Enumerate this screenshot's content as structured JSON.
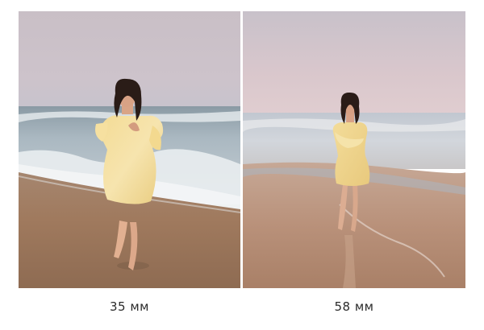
{
  "photos": [
    {
      "caption": "35 мм"
    },
    {
      "caption": "58 мм"
    }
  ]
}
